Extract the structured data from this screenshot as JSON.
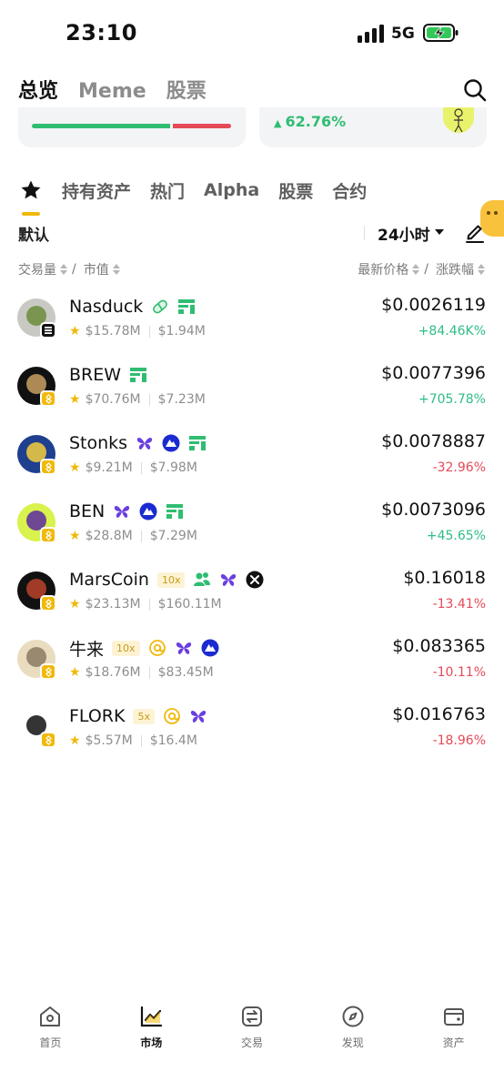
{
  "status_bar": {
    "time": "23:10",
    "network": "5G"
  },
  "top_tabs": [
    "总览",
    "Meme",
    "股票"
  ],
  "banner": {
    "right_change": "62.76%"
  },
  "sub_tabs": [
    "持有资产",
    "热门",
    "Alpha",
    "股票",
    "合约"
  ],
  "filters": {
    "default_label": "默认",
    "period": "24小时"
  },
  "sort_headers": {
    "volume": "交易量",
    "slash": "/",
    "market_cap": "市值",
    "latest_price": "最新价格",
    "change": "涨跌幅"
  },
  "tokens": [
    {
      "name": "Nasduck",
      "chain": "sol",
      "volume": "$15.78M",
      "market_cap": "$1.94M",
      "price": "$0.0026119",
      "change": "+84.46K%",
      "direction": "up",
      "tags": [
        "pill-icon",
        "exchange-card-icon"
      ]
    },
    {
      "name": "BREW",
      "chain": "bsc",
      "volume": "$70.76M",
      "market_cap": "$7.23M",
      "price": "$0.0077396",
      "change": "+705.78%",
      "direction": "up",
      "tags": [
        "exchange-card-icon"
      ]
    },
    {
      "name": "Stonks",
      "chain": "bsc",
      "volume": "$9.21M",
      "market_cap": "$7.98M",
      "price": "$0.0078887",
      "change": "-32.96%",
      "direction": "down",
      "tags": [
        "butterfly-icon",
        "mountain-badge-icon",
        "exchange-card-icon"
      ]
    },
    {
      "name": "BEN",
      "chain": "bsc",
      "volume": "$28.8M",
      "market_cap": "$7.29M",
      "price": "$0.0073096",
      "change": "+45.65%",
      "direction": "up",
      "tags": [
        "butterfly-icon",
        "mountain-badge-icon",
        "exchange-card-icon"
      ]
    },
    {
      "name": "MarsCoin",
      "chain": "bsc",
      "leverage": "10x",
      "volume": "$23.13M",
      "market_cap": "$160.11M",
      "price": "$0.16018",
      "change": "-13.41%",
      "direction": "down",
      "tags": [
        "people-icon",
        "butterfly-icon",
        "x-logo-icon"
      ]
    },
    {
      "name": "牛来",
      "chain": "bsc",
      "leverage": "10x",
      "volume": "$18.76M",
      "market_cap": "$83.45M",
      "price": "$0.083365",
      "change": "-10.11%",
      "direction": "down",
      "tags": [
        "at-icon",
        "butterfly-icon",
        "mountain-badge-icon"
      ]
    },
    {
      "name": "FLORK",
      "chain": "bsc",
      "leverage": "5x",
      "volume": "$5.57M",
      "market_cap": "$16.4M",
      "price": "$0.016763",
      "change": "-18.96%",
      "direction": "down",
      "tags": [
        "at-icon",
        "butterfly-icon"
      ]
    }
  ],
  "bottom_nav": [
    {
      "label": "首页",
      "icon": "home-icon"
    },
    {
      "label": "市场",
      "icon": "market-chart-icon",
      "active": true
    },
    {
      "label": "交易",
      "icon": "trade-swap-icon"
    },
    {
      "label": "发现",
      "icon": "compass-icon"
    },
    {
      "label": "资产",
      "icon": "wallet-icon"
    }
  ],
  "colors": {
    "up": "#2ebd85",
    "down": "#e54a57",
    "accent": "#f0b90b"
  }
}
